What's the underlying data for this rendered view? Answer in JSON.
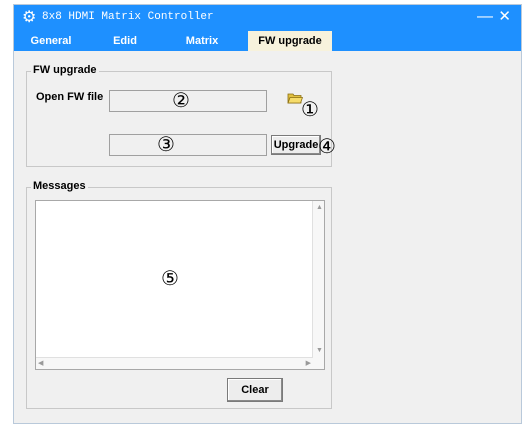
{
  "window": {
    "title": "8x8 HDMI Matrix Controller",
    "app_icon": "gear-icon",
    "minimize": "—",
    "close": "✕"
  },
  "tabs": [
    {
      "label": "General",
      "active": false
    },
    {
      "label": "Edid",
      "active": false
    },
    {
      "label": "Matrix",
      "active": false
    },
    {
      "label": "FW upgrade",
      "active": true
    }
  ],
  "fw_upgrade": {
    "group_title": "FW upgrade",
    "open_label": "Open FW file",
    "file_path_value": "",
    "status_value": "",
    "upgrade_button": "Upgrade",
    "folder_icon": "folder-open-icon",
    "callouts": [
      "①",
      "②",
      "③",
      "④"
    ]
  },
  "messages": {
    "group_title": "Messages",
    "content": "",
    "callout": "⑤",
    "clear_button": "Clear"
  },
  "colors": {
    "titlebar": "#1e90ff",
    "active_tab": "#f7f2dc",
    "panel": "#f0f0f0"
  }
}
